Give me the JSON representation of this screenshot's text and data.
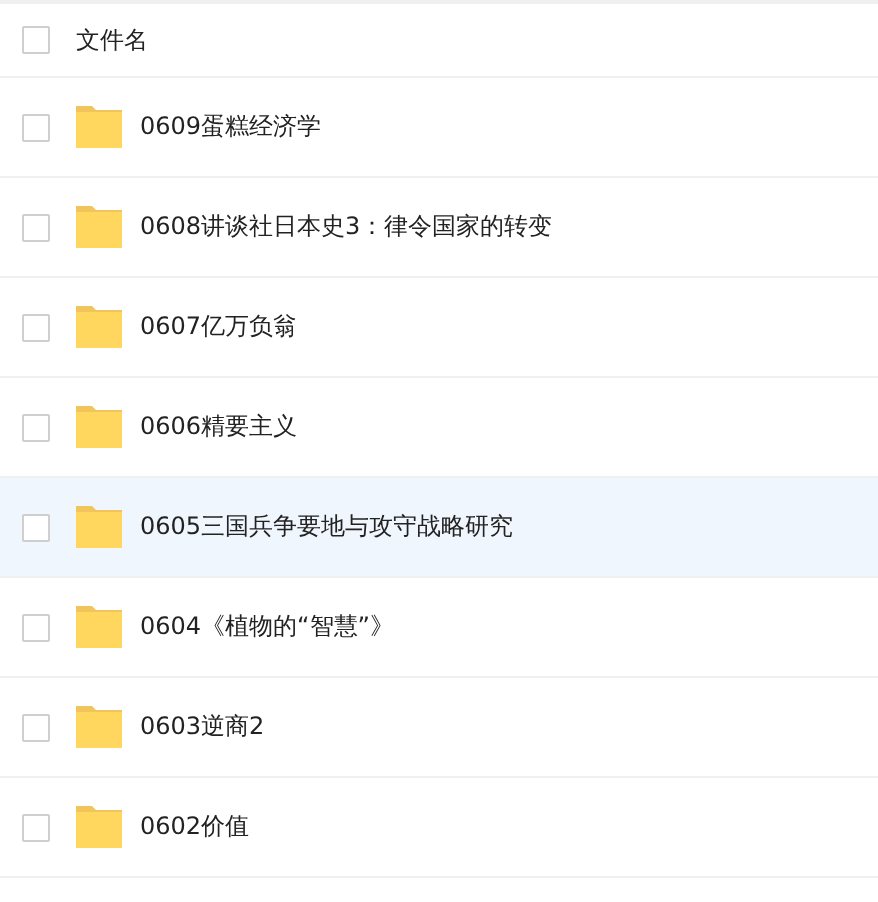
{
  "header": {
    "label": "文件名",
    "checked": false
  },
  "files": [
    {
      "name": "0609蛋糕经济学",
      "checked": false,
      "hovered": false
    },
    {
      "name": "0608讲谈社日本史3：律令国家的转变",
      "checked": false,
      "hovered": false
    },
    {
      "name": "0607亿万负翁",
      "checked": false,
      "hovered": false
    },
    {
      "name": "0606精要主义",
      "checked": false,
      "hovered": false
    },
    {
      "name": "0605三国兵争要地与攻守战略研究",
      "checked": false,
      "hovered": true
    },
    {
      "name": "0604《植物的“智慧”》",
      "checked": false,
      "hovered": false
    },
    {
      "name": "0603逆商2",
      "checked": false,
      "hovered": false
    },
    {
      "name": "0602价值",
      "checked": false,
      "hovered": false
    }
  ]
}
